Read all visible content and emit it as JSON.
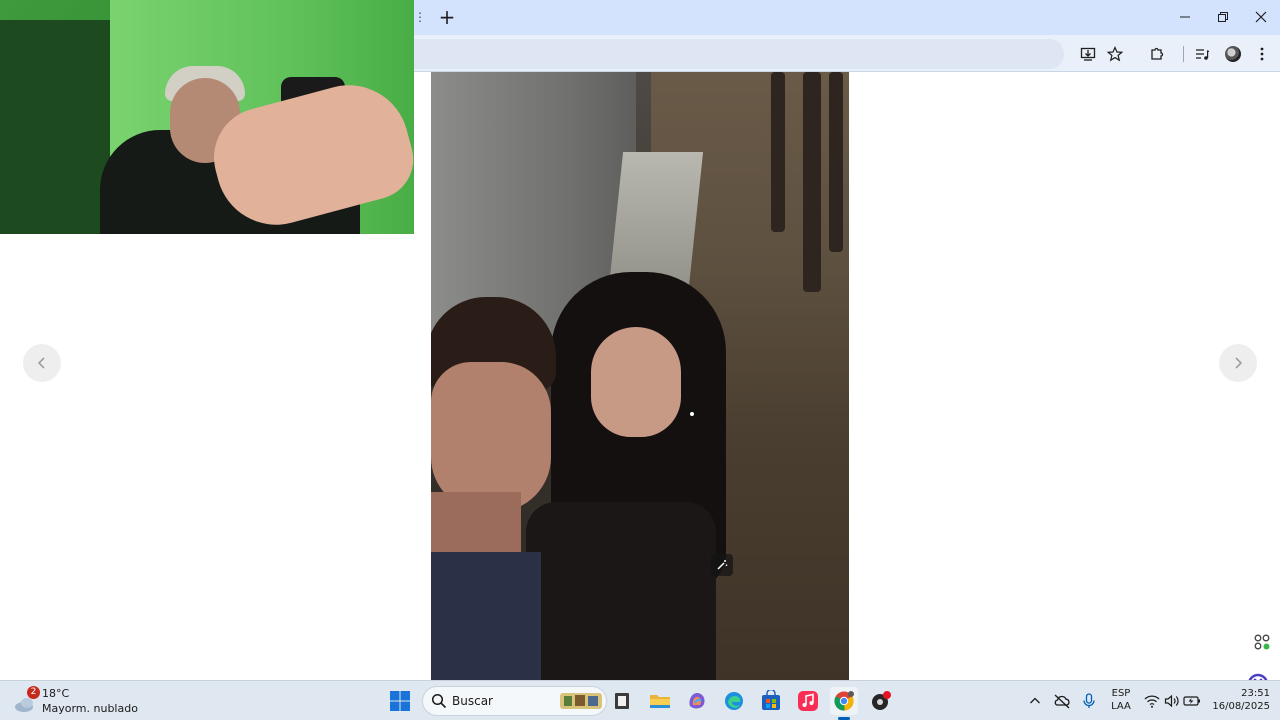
{
  "browser": {
    "new_tab_label": "+",
    "tab_dots": "⋮",
    "window_controls": {
      "minimize": "minimize-icon",
      "maximize": "restore-icon",
      "close": "close-icon"
    },
    "toolbar_icons": [
      "install-app-icon",
      "bookmark-star-icon",
      "extensions-puzzle-icon",
      "media-controls-icon",
      "profile-avatar-icon",
      "more-menu-icon"
    ],
    "accent": "#d3e3fd"
  },
  "viewer": {
    "prev_icon": "chevron-left-icon",
    "next_icon": "chevron-right-icon"
  },
  "taskbar": {
    "weather": {
      "badge": "2",
      "temp": "18°C",
      "description": "Mayorm. nublado"
    },
    "search_placeholder": "Buscar",
    "apps": [
      "widgets-icon",
      "file-manager-icon",
      "file-explorer-icon",
      "copilot-icon",
      "edge-icon",
      "store-icon",
      "music-icon",
      "chrome-icon",
      "screen-recorder-icon"
    ],
    "language": {
      "line1": "ESP",
      "line2": "LAA"
    },
    "clock": {
      "time": "23:51",
      "date": "16/08/2025"
    }
  }
}
